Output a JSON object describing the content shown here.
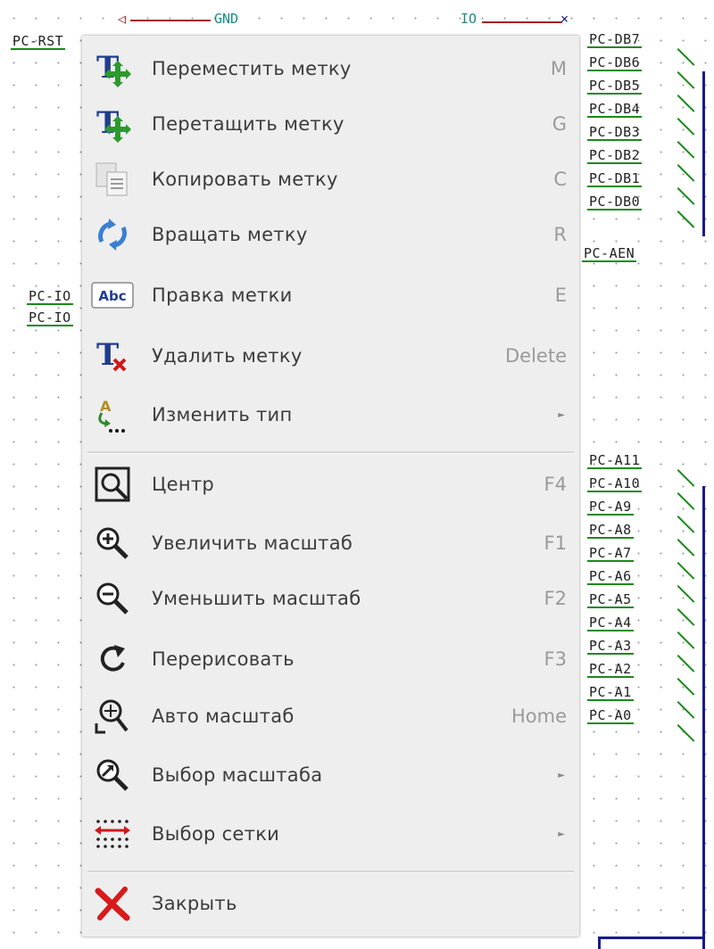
{
  "schematic": {
    "top_left_label": "PC-RST",
    "gnd_label": "GND",
    "io_label": "IO",
    "right_db_labels": [
      "PC-DB7",
      "PC-DB6",
      "PC-DB5",
      "PC-DB4",
      "PC-DB3",
      "PC-DB2",
      "PC-DB1",
      "PC-DB0"
    ],
    "aen_label": "PC-AEN",
    "left_labels": [
      "PC-IO",
      "PC-IO"
    ],
    "right_a_labels": [
      "PC-A11",
      "PC-A10",
      "PC-A9",
      "PC-A8",
      "PC-A7",
      "PC-A6",
      "PC-A5",
      "PC-A4",
      "PC-A3",
      "PC-A2",
      "PC-A1",
      "PC-A0"
    ]
  },
  "menu": {
    "items": [
      {
        "label": "Переместить метку",
        "shortcut": "M",
        "icon": "move-label-icon"
      },
      {
        "label": "Перетащить метку",
        "shortcut": "G",
        "icon": "drag-label-icon"
      },
      {
        "label": "Копировать метку",
        "shortcut": "C",
        "icon": "copy-icon"
      },
      {
        "label": "Вращать метку",
        "shortcut": "R",
        "icon": "rotate-icon"
      },
      {
        "label": "Правка метки",
        "shortcut": "E",
        "icon": "edit-text-icon",
        "icon_text": "Abc"
      },
      {
        "label": "Удалить метку",
        "shortcut": "Delete",
        "icon": "delete-label-icon"
      },
      {
        "label": "Изменить тип",
        "shortcut": "",
        "icon": "change-type-icon",
        "submenu": true
      },
      {
        "label": "Центр",
        "shortcut": "F4",
        "icon": "center-icon"
      },
      {
        "label": "Увеличить масштаб",
        "shortcut": "F1",
        "icon": "zoom-in-icon"
      },
      {
        "label": "Уменьшить масштаб",
        "shortcut": "F2",
        "icon": "zoom-out-icon"
      },
      {
        "label": "Перерисовать",
        "shortcut": "F3",
        "icon": "redraw-icon"
      },
      {
        "label": "Авто масштаб",
        "shortcut": "Home",
        "icon": "zoom-fit-icon"
      },
      {
        "label": "Выбор масштаба",
        "shortcut": "",
        "icon": "zoom-select-icon",
        "submenu": true
      },
      {
        "label": "Выбор сетки",
        "shortcut": "",
        "icon": "grid-select-icon",
        "submenu": true
      },
      {
        "label": "Закрыть",
        "shortcut": "",
        "icon": "close-icon"
      }
    ],
    "submenu_arrow": "►",
    "colors": {
      "background": "#eeeeee",
      "label": "#3b3b3b",
      "shortcut": "#9a9a9a",
      "wire": "#1a8a1a",
      "bus": "#1a1a8c"
    }
  }
}
